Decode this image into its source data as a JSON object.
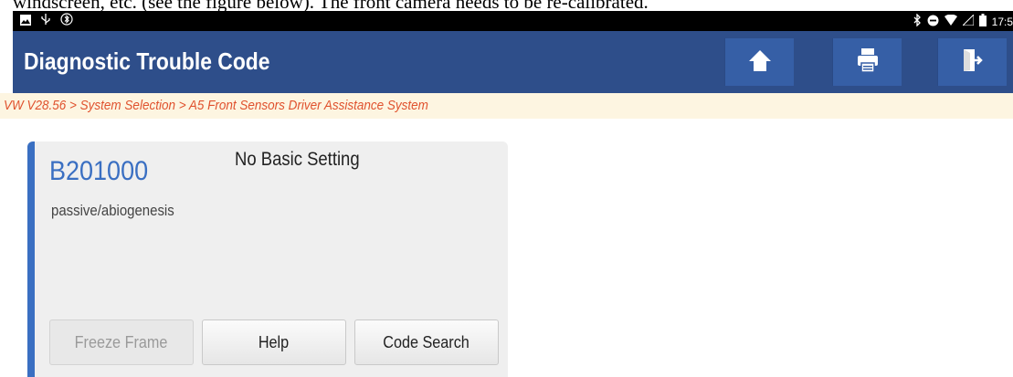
{
  "document": {
    "overlay_text": "windscreen, etc. (see the figure below). The front camera needs to be re-calibrated."
  },
  "status_bar": {
    "left_icons": [
      "image-icon",
      "usb-icon",
      "bluetooth-badge-icon"
    ],
    "right_icons": [
      "bluetooth-icon",
      "do-not-disturb-icon",
      "wifi-icon",
      "signal-icon",
      "battery-icon"
    ],
    "time": "17:5"
  },
  "app_bar": {
    "title": "Diagnostic Trouble Code",
    "buttons": [
      {
        "name": "home",
        "icon": "home-icon"
      },
      {
        "name": "print",
        "icon": "print-icon"
      },
      {
        "name": "exit",
        "icon": "exit-icon"
      }
    ],
    "colors": {
      "bar": "#2e4e8a",
      "button": "#365fa6"
    }
  },
  "breadcrumb": {
    "text": "VW V28.56 > System Selection > A5 Front Sensors Driver Assistance System",
    "color": "#e0522e"
  },
  "dtc_card": {
    "code": "B201000",
    "status": "No Basic Setting",
    "description": "passive/abiogenesis",
    "accent_color": "#3a6fc2",
    "buttons": {
      "freeze_frame": "Freeze Frame",
      "help": "Help",
      "code_search": "Code Search"
    }
  }
}
